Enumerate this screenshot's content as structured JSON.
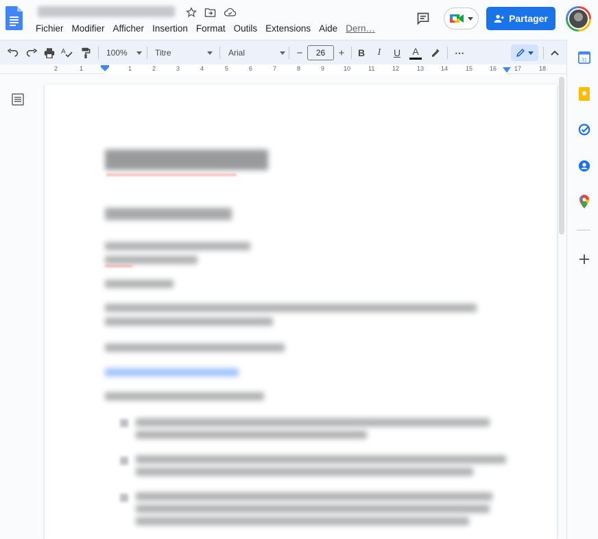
{
  "header": {
    "menu": [
      "Fichier",
      "Modifier",
      "Afficher",
      "Insertion",
      "Format",
      "Outils",
      "Extensions",
      "Aide",
      "Dern…"
    ],
    "share_label": "Partager",
    "icons": [
      "docs-logo-icon",
      "star-icon",
      "move-folder-icon",
      "cloud-status-icon",
      "comment-icon",
      "meet-icon",
      "share-person-icon",
      "account-avatar"
    ]
  },
  "toolbar": {
    "zoom": "100%",
    "style": "Titre",
    "font": "Arial",
    "font_size": "26",
    "minus": "−",
    "plus": "+",
    "bold": "B",
    "italic": "I",
    "underline": "U",
    "text_color_glyph": "A",
    "more": "⋯"
  },
  "ruler": {
    "labels": [
      "2",
      "1",
      "1",
      "2",
      "3",
      "4",
      "5",
      "6",
      "7",
      "8",
      "9",
      "10",
      "11",
      "12",
      "13",
      "14",
      "15",
      "16",
      "17",
      "18"
    ]
  },
  "colors": {
    "accent": "#1a73e8",
    "toolbar_bg": "#edf2fa",
    "page_bg": "#f9fbfd",
    "edit_mode_bg": "#d3e3fd"
  },
  "side_panel": {
    "icons": [
      "calendar-icon",
      "keep-icon",
      "tasks-icon",
      "contacts-icon",
      "maps-icon",
      "add-icon"
    ]
  }
}
